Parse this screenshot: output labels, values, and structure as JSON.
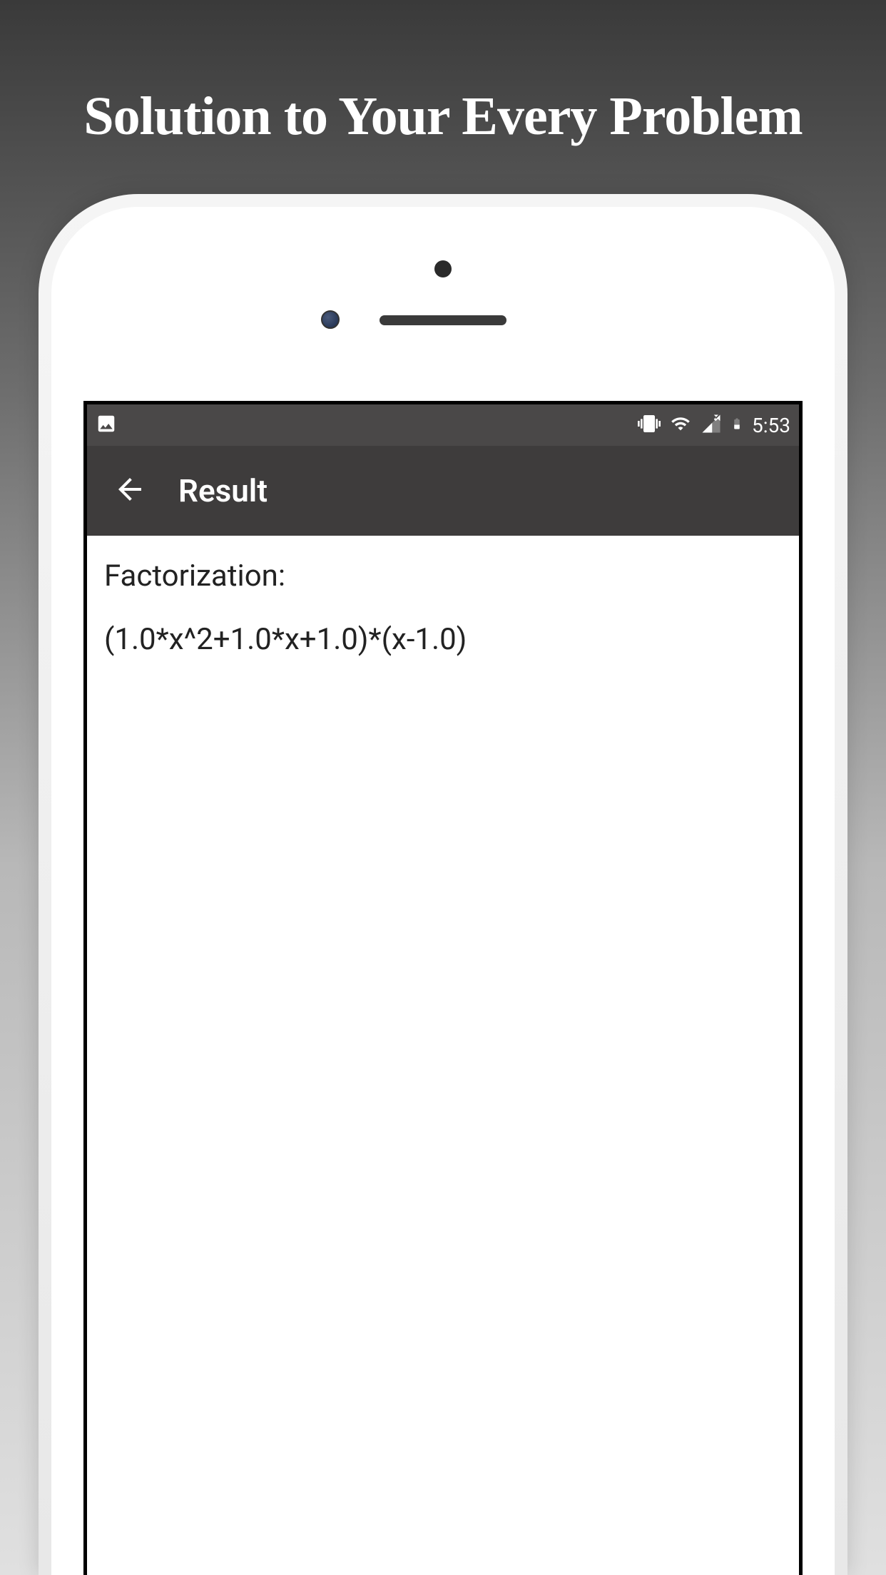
{
  "promo": {
    "title": "Solution to Your Every Problem"
  },
  "statusBar": {
    "time": "5:53"
  },
  "appBar": {
    "title": "Result"
  },
  "content": {
    "label": "Factorization:",
    "value": "(1.0*x^2+1.0*x+1.0)*(x-1.0)"
  }
}
